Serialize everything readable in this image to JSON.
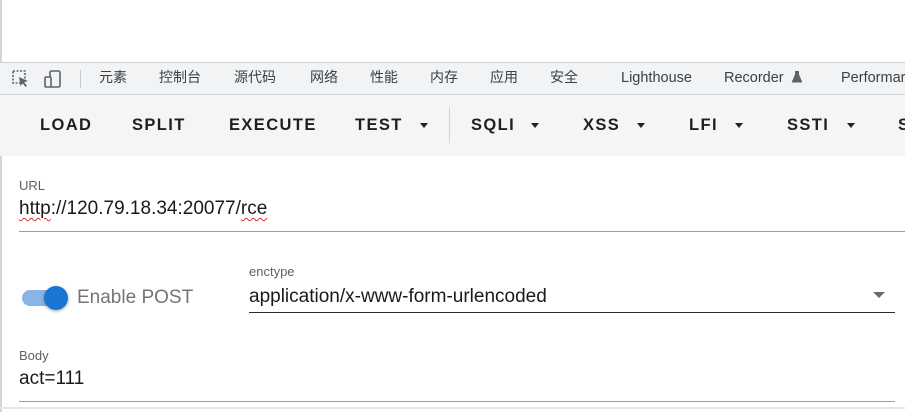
{
  "devtools": {
    "tabs": [
      {
        "label": "元素"
      },
      {
        "label": "控制台"
      },
      {
        "label": "源代码"
      },
      {
        "label": "网络"
      },
      {
        "label": "性能"
      },
      {
        "label": "内存"
      },
      {
        "label": "应用"
      },
      {
        "label": "安全"
      },
      {
        "label": "Lighthouse"
      },
      {
        "label": "Recorder"
      },
      {
        "label": "Performar"
      }
    ]
  },
  "hackbar": {
    "buttons": {
      "load": "LOAD",
      "split": "SPLIT",
      "execute": "EXECUTE",
      "test": "TEST",
      "sqli": "SQLI",
      "xss": "XSS",
      "lfi": "LFI",
      "ssti": "SSTI",
      "more": "S"
    },
    "url": {
      "label": "URL",
      "value_prefix": "http",
      "value_middle": "://120.79.18.34:20077/",
      "value_suffix": "rce"
    },
    "post": {
      "toggle_label": "Enable POST",
      "enabled": true,
      "enctype_label": "enctype",
      "enctype_value": "application/x-www-form-urlencoded"
    },
    "body": {
      "label": "Body",
      "value": "act=111"
    }
  },
  "colors": {
    "toggle_thumb": "#1976d2",
    "toggle_track": "#8ab4e8",
    "toolbar_bg": "#f5f5f5",
    "devtools_tabs_bg": "#f1f3f4"
  }
}
